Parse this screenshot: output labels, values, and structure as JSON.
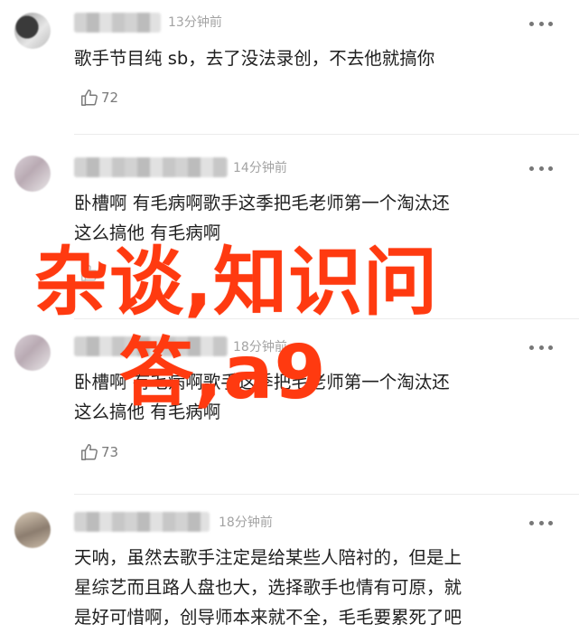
{
  "colors": {
    "watermark": "#ff3a10",
    "meta_text": "#a3a3a3",
    "body_text": "#1f1f1f"
  },
  "comments": [
    {
      "time": "13分钟前",
      "text": "歌手节目纯 sb，去了没法录创，不去他就搞你",
      "likes": "72",
      "avatar_icon": "avatar-icon"
    },
    {
      "time": "14分钟前",
      "text": "卧槽啊 有毛病啊歌手这季把毛老师第一个淘汰还\n这么搞他 有毛病啊",
      "likes": "",
      "avatar_icon": "avatar-icon"
    },
    {
      "time": "18分钟前",
      "text": "卧槽啊 有毛病啊歌手这季把毛老师第一个淘汰还\n这么搞他 有毛病啊",
      "likes": "73",
      "avatar_icon": "avatar-icon"
    },
    {
      "time": "18分钟前",
      "text": "天呐，虽然去歌手注定是给某些人陪衬的，但是上\n星综艺而且路人盘也大，选择歌手也情有可原，就\n是好可惜啊，创导师本来就不全，毛毛要累死了吧",
      "likes": "",
      "avatar_icon": "avatar-icon"
    }
  ],
  "watermark": {
    "line1": "杂谈,知识问",
    "line2": "答,a9"
  },
  "icons": {
    "like": "thumbs-up-icon",
    "more": "more-dots-icon"
  }
}
